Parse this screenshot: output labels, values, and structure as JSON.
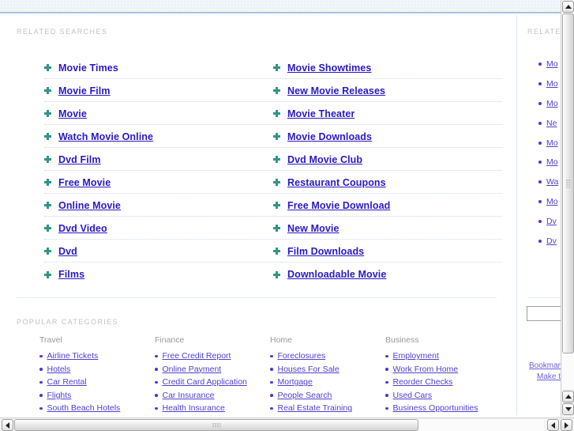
{
  "sections": {
    "related_searches_label": "RELATED SEARCHES",
    "popular_categories_label": "POPULAR CATEGORIES",
    "aside_related_label": "RELATED"
  },
  "related_searches": {
    "bullet_icon": "sparkle-icon",
    "link_color": "#2a18c8",
    "bullet_color": "#2e9688",
    "rows": [
      {
        "left": "Movie Times",
        "left_underlined": false,
        "right": "Movie Showtimes"
      },
      {
        "left": "Movie Film",
        "left_underlined": true,
        "right": "New Movie Releases"
      },
      {
        "left": "Movie",
        "left_underlined": true,
        "right": "Movie Theater"
      },
      {
        "left": "Watch Movie Online",
        "left_underlined": true,
        "right": "Movie Downloads"
      },
      {
        "left": "Dvd Film",
        "left_underlined": true,
        "right": "Dvd Movie Club"
      },
      {
        "left": "Free Movie",
        "left_underlined": true,
        "right": "Restaurant Coupons"
      },
      {
        "left": "Online Movie",
        "left_underlined": true,
        "right": "Free Movie Download"
      },
      {
        "left": "Dvd Video",
        "left_underlined": true,
        "right": "New Movie"
      },
      {
        "left": "Dvd",
        "left_underlined": true,
        "right": "Film Downloads"
      },
      {
        "left": "Films",
        "left_underlined": true,
        "right": "Downloadable Movie"
      }
    ]
  },
  "popular_categories": {
    "bullet_icon": "round-bullet-icon",
    "link_color": "#5040cf",
    "columns": [
      {
        "title": "Travel",
        "items": [
          "Airline Tickets",
          "Hotels",
          "Car Rental",
          "Flights",
          "South Beach Hotels"
        ]
      },
      {
        "title": "Finance",
        "items": [
          "Free Credit Report",
          "Online Payment",
          "Credit Card Application",
          "Car Insurance",
          "Health Insurance"
        ]
      },
      {
        "title": "Home",
        "items": [
          "Foreclosures",
          "Houses For Sale",
          "Mortgage",
          "People Search",
          "Real Estate Training"
        ]
      },
      {
        "title": "Business",
        "items": [
          "Employment",
          "Work From Home",
          "Reorder Checks",
          "Used Cars",
          "Business Opportunities"
        ]
      }
    ]
  },
  "aside": {
    "items": [
      "Mo",
      "Mo",
      "Mo",
      "Ne",
      "Mo",
      "Mo",
      "Wa",
      "Mo",
      "Dv",
      "Dv"
    ],
    "search_value": "",
    "search_placeholder": "",
    "bookmark_label": "Bookmark",
    "make_this_label": "Make thi"
  },
  "scrollbars": {
    "vertical": {
      "up_icon": "triangle-up-icon",
      "down_icon": "triangle-down-icon"
    },
    "horizontal": {
      "left_icon": "triangle-left-icon",
      "right_icon": "triangle-right-icon"
    }
  }
}
